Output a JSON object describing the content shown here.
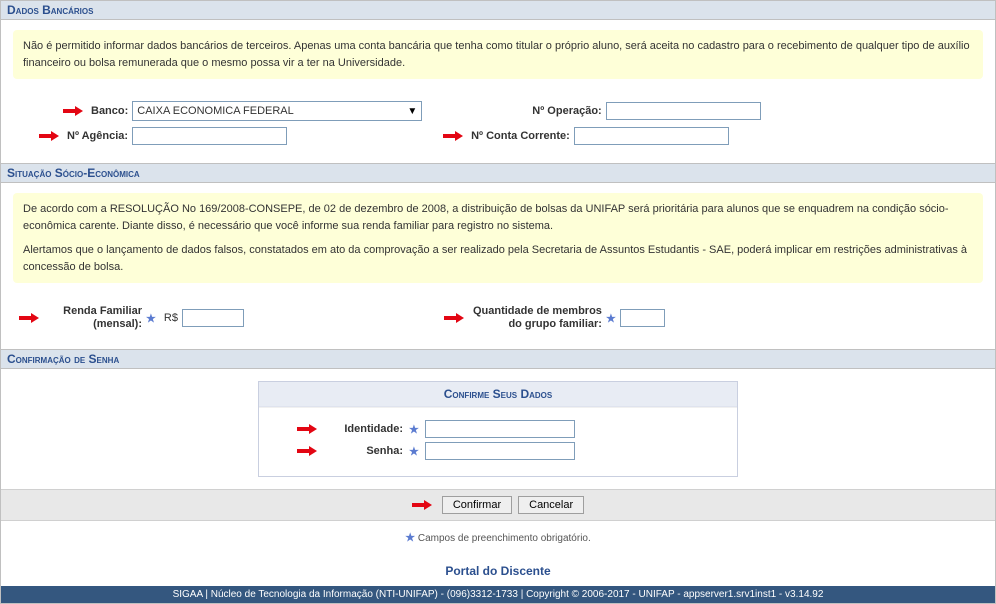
{
  "sections": {
    "bank": {
      "title": "Dados Bancários",
      "notice": "Não é permitido informar dados bancários de terceiros. Apenas uma conta bancária que tenha como titular o próprio aluno, será aceita no cadastro para o recebimento de qualquer tipo de auxílio financeiro ou bolsa remunerada que o mesmo possa vir a ter na Universidade.",
      "fields": {
        "banco_label": "Banco:",
        "banco_value": "CAIXA ECONOMICA FEDERAL",
        "operacao_label": "Nº Operação:",
        "agencia_label": "Nº Agência:",
        "conta_label": "Nº Conta Corrente:"
      }
    },
    "socio": {
      "title": "Situação Sócio-Econômica",
      "notice1": "De acordo com a RESOLUÇÃO No 169/2008-CONSEPE, de 02 de dezembro de 2008, a distribuição de bolsas da UNIFAP será prioritária para alunos que se enquadrem na condição sócio-econômica carente. Diante disso, é necessário que você informe sua renda familiar para registro no sistema.",
      "notice2": "Alertamos que o lançamento de dados falsos, constatados em ato da comprovação a ser realizado pela Secretaria de Assuntos Estudantis - SAE, poderá implicar em restrições administrativas à concessão de bolsa.",
      "fields": {
        "renda_label": "Renda Familiar (mensal):",
        "renda_prefix": "R$",
        "membros_label": "Quantidade de membros do grupo familiar:"
      }
    },
    "senha": {
      "title": "Confirmação de Senha",
      "box_title": "Confirme Seus Dados",
      "fields": {
        "identidade_label": "Identidade:",
        "senha_label": "Senha:"
      }
    }
  },
  "buttons": {
    "confirmar": "Confirmar",
    "cancelar": "Cancelar"
  },
  "legend": "Campos de preenchimento obrigatório.",
  "portal_link": "Portal do Discente",
  "footer": "SIGAA | Núcleo de Tecnologia da Informação (NTI-UNIFAP) - (096)3312-1733 | Copyright © 2006-2017 - UNIFAP - appserver1.srv1inst1 - v3.14.92"
}
